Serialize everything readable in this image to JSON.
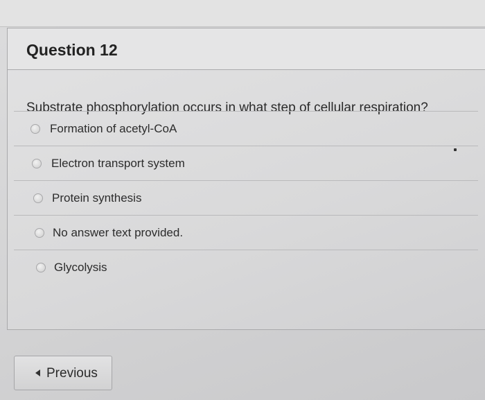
{
  "question": {
    "title": "Question 12",
    "prompt": "Substrate phosphorylation occurs in what step of cellular respiration?",
    "answers": [
      {
        "label": "Formation of acetyl-CoA",
        "selected": false
      },
      {
        "label": "Electron transport system",
        "selected": false
      },
      {
        "label": "Protein synthesis",
        "selected": false
      },
      {
        "label": "No answer text provided.",
        "selected": false
      },
      {
        "label": "Glycolysis",
        "selected": false
      }
    ]
  },
  "navigation": {
    "previous_label": "Previous",
    "previous_icon": "caret-left-icon"
  }
}
